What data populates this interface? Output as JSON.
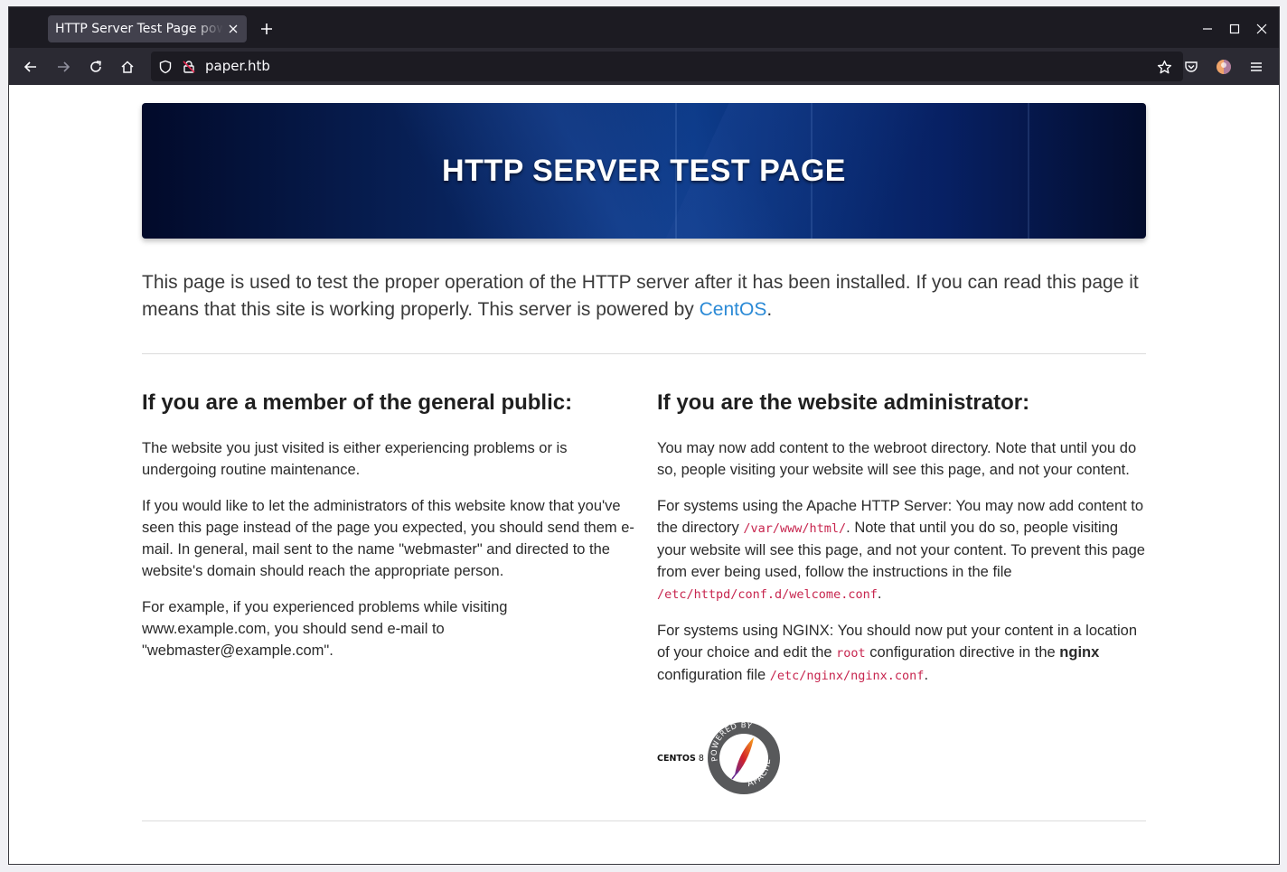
{
  "browser": {
    "tab_title": "HTTP Server Test Page powered by CentOS",
    "url": "paper.htb",
    "icons": [
      "close-tab-icon",
      "new-tab-icon",
      "minimize-icon",
      "maximize-icon",
      "window-close-icon",
      "back-icon",
      "forward-icon",
      "reload-icon",
      "home-icon",
      "shield-icon",
      "insecure-lock-icon",
      "bookmark-star-icon",
      "pocket-icon",
      "profile-avatar-icon",
      "hamburger-menu-icon"
    ]
  },
  "page": {
    "banner": {
      "title_light": "HTTP SERVER ",
      "title_bold": "TEST PAGE"
    },
    "intro": {
      "text": "This page is used to test the proper operation of the HTTP server after it has been installed. If you can read this page it means that this site is working properly. This server is powered by ",
      "link": "CentOS",
      "after_link": "."
    },
    "public": {
      "heading": "If you are a member of the general public:",
      "p1": "The website you just visited is either experiencing problems or is undergoing routine maintenance.",
      "p2": "If you would like to let the administrators of this website know that you've seen this page instead of the page you expected, you should send them e-mail. In general, mail sent to the name \"webmaster\" and directed to the website's domain should reach the appropriate person.",
      "p3": "For example, if you experienced problems while visiting www.example.com, you should send e-mail to \"webmaster@example.com\"."
    },
    "admin": {
      "heading": "If you are the website administrator:",
      "p1": "You may now add content to the webroot directory. Note that until you do so, people visiting your website will see this page, and not your content.",
      "p2_a": "For systems using the Apache HTTP Server: You may now add content to the directory ",
      "p2_code1": "/var/www/html/",
      "p2_b": ". Note that until you do so, people visiting your website will see this page, and not your content. To prevent this page from ever being used, follow the instructions in the file ",
      "p2_code2": "/etc/httpd/conf.d/welcome.conf",
      "p2_c": ".",
      "p3_a": "For systems using NGINX: You should now put your content in a location of your choice and edit the ",
      "p3_code1": "root",
      "p3_b": " configuration directive in the ",
      "p3_bold": "nginx",
      "p3_c": " configuration file ",
      "p3_code2": "/etc/nginx/nginx.conf",
      "p3_d": "."
    },
    "logos": {
      "centos_label": "CENTOS",
      "centos_version": " 8",
      "apache_badge_top": "POWERED BY",
      "apache_badge_bottom": "APACHE"
    }
  }
}
